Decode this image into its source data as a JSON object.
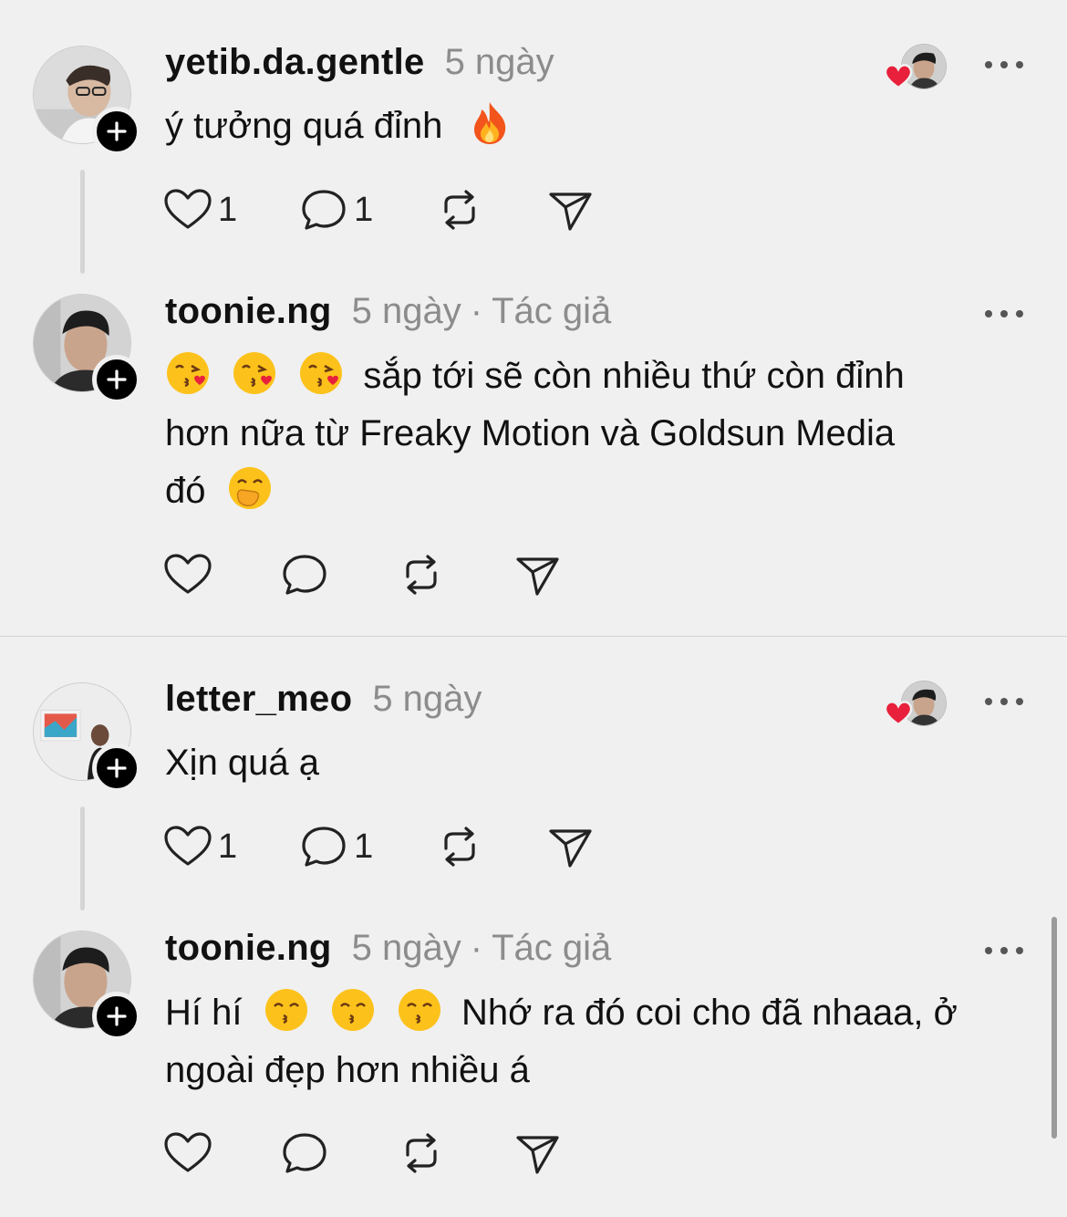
{
  "threads": [
    {
      "comment": {
        "username": "yetib.da.gentle",
        "time": "5 ngày",
        "text": "ý tưởng quá đỉnh",
        "emoji": "fire-emoji",
        "likes": "1",
        "replies": "1"
      },
      "reply": {
        "username": "toonie.ng",
        "time": "5 ngày",
        "author_label": "Tác giả",
        "separator": "·",
        "text_line1": "sắp tới sẽ còn nhiều thứ còn đỉnh",
        "text_line2": "hơn nữa từ Freaky Motion và Goldsun Media",
        "text_line3": "đó",
        "emojis": [
          "kiss-heart-emoji",
          "kiss-heart-emoji",
          "kiss-heart-emoji",
          "hand-over-mouth-emoji"
        ]
      }
    },
    {
      "comment": {
        "username": "letter_meo",
        "time": "5 ngày",
        "text": "Xịn quá ạ",
        "likes": "1",
        "replies": "1"
      },
      "reply": {
        "username": "toonie.ng",
        "time": "5 ngày",
        "author_label": "Tác giả",
        "separator": "·",
        "text_line1_a": "Hí hí",
        "text_line1_b": "Nhớ ra đó coi cho đã nhaaa, ở",
        "text_line2": "ngoài đẹp hơn nhiều á",
        "emojis": [
          "kissing-smiling-eyes-emoji",
          "kissing-smiling-eyes-emoji",
          "kissing-smiling-eyes-emoji"
        ]
      }
    }
  ],
  "icons": {
    "like": "heart-icon",
    "reply": "comment-icon",
    "repost": "repost-icon",
    "share": "send-icon",
    "more": "more-icon",
    "follow": "plus-icon"
  },
  "colors": {
    "background": "#f0f0f0",
    "text": "#111111",
    "muted": "#8c8c8c",
    "heart_red": "#e8203b"
  }
}
